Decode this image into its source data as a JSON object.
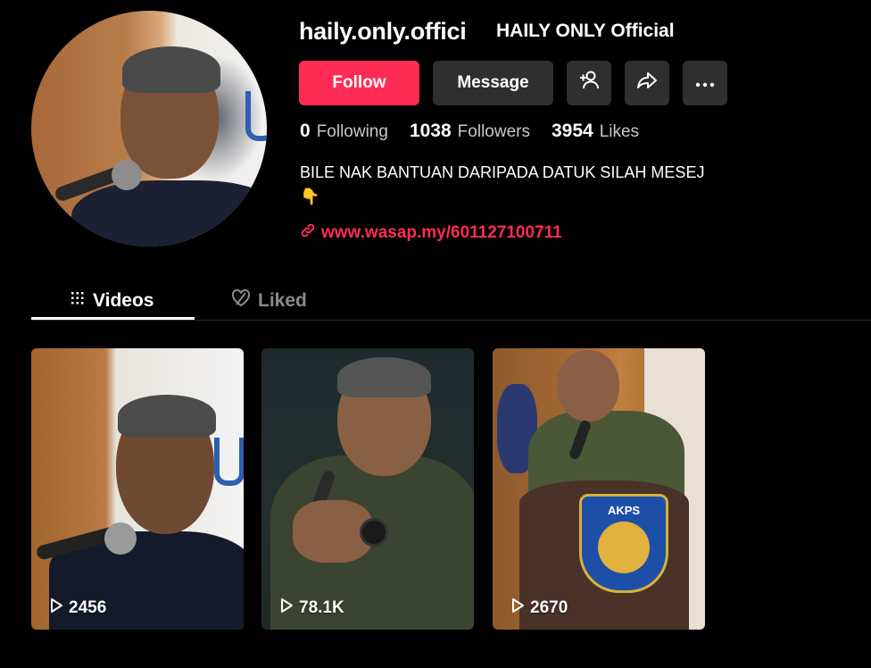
{
  "profile": {
    "handle": "haily.only.offici",
    "nickname": "HAILY ONLY Official",
    "follow_label": "Follow",
    "message_label": "Message",
    "stats": [
      {
        "value": "0",
        "label": "Following"
      },
      {
        "value": "1038",
        "label": "Followers"
      },
      {
        "value": "3954",
        "label": "Likes"
      }
    ],
    "bio_line1": "BILE NAK BANTUAN DARIPADA DATUK SILAH MESEJ",
    "bio_emoji": "👇",
    "link_text": "www.wasap.my/601127100711"
  },
  "tabs": [
    {
      "label": "Videos",
      "active": true
    },
    {
      "label": "Liked",
      "active": false
    }
  ],
  "videos": [
    {
      "views": "2456"
    },
    {
      "views": "78.1K"
    },
    {
      "views": "2670"
    }
  ],
  "video3_badge": "AKPS",
  "colors": {
    "accent": "#fe2c55",
    "button_bg": "#2f2f2f",
    "background": "#000000"
  },
  "icons": [
    "add-friend-icon",
    "share-icon",
    "more-icon",
    "link-icon",
    "grid-icon",
    "liked-heart-icon",
    "play-icon"
  ]
}
